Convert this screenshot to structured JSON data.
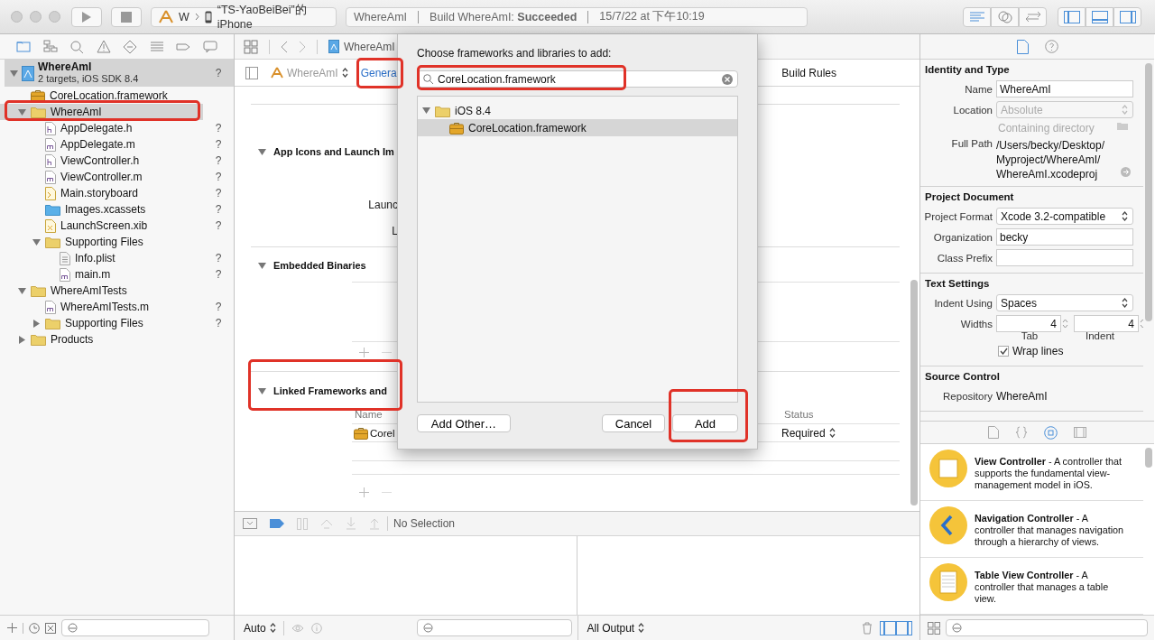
{
  "toolbar": {
    "scheme": "W",
    "device": "“TS-YaoBeiBei”的 iPhone",
    "activity": [
      "WhereAmI",
      "Build WhereAmI: **Succeeded**",
      "15/7/22 at 下午10:19"
    ]
  },
  "navigator": {
    "project": {
      "name": "WhereAmI",
      "subtitle": "2 targets, iOS SDK 8.4",
      "badge": "?",
      "expanded": true,
      "selected": true
    },
    "tree": [
      {
        "name": "CoreLocation.framework",
        "kind": "framework",
        "selected": false
      },
      {
        "name": "WhereAmI",
        "kind": "folder",
        "expanded": true,
        "selected": true,
        "children": [
          {
            "name": "AppDelegate.h",
            "kind": "header",
            "badge": "?",
            "selected": false
          },
          {
            "name": "AppDelegate.m",
            "kind": "source",
            "badge": "?",
            "selected": false
          },
          {
            "name": "ViewController.h",
            "kind": "header",
            "badge": "?",
            "selected": false
          },
          {
            "name": "ViewController.m",
            "kind": "source",
            "badge": "?",
            "selected": false
          },
          {
            "name": "Main.storyboard",
            "kind": "storyboard",
            "badge": "?",
            "selected": false
          },
          {
            "name": "Images.xcassets",
            "kind": "assets",
            "badge": "?",
            "selected": false
          },
          {
            "name": "LaunchScreen.xib",
            "kind": "xib",
            "badge": "?",
            "selected": false
          },
          {
            "name": "Supporting Files",
            "kind": "folder",
            "expanded": true,
            "selected": false,
            "children": [
              {
                "name": "Info.plist",
                "kind": "plist",
                "badge": "?",
                "selected": false
              },
              {
                "name": "main.m",
                "kind": "source",
                "badge": "?",
                "selected": false
              }
            ]
          }
        ]
      },
      {
        "name": "WhereAmITests",
        "kind": "folder",
        "expanded": true,
        "selected": false,
        "children": [
          {
            "name": "WhereAmITests.m",
            "kind": "source",
            "badge": "?",
            "selected": false
          },
          {
            "name": "Supporting Files",
            "kind": "folder",
            "expanded": false,
            "badge": "?",
            "selected": false
          }
        ]
      },
      {
        "name": "Products",
        "kind": "folder",
        "expanded": false,
        "selected": false
      }
    ]
  },
  "editor": {
    "breadcrumb": "WhereAmI",
    "target": "WhereAmI",
    "tabs": [
      {
        "label": "Genera",
        "selected": true
      },
      {
        "label": "Build Rules",
        "selected": false
      }
    ],
    "sections": [
      {
        "kind": "labels",
        "title": "App Icons and Launch Im",
        "expanded": true,
        "labels": [
          "Launc",
          "L"
        ]
      },
      {
        "kind": "empty",
        "title": "Embedded Binaries",
        "expanded": true
      },
      {
        "kind": "table",
        "title": "Linked Frameworks and",
        "expanded": true,
        "columns": [
          "Name",
          "Status"
        ],
        "rows": [
          {
            "name": "Corel",
            "status": "Required"
          }
        ]
      }
    ],
    "debug": {
      "status": "No Selection",
      "variables_filter": "Auto",
      "output_filter": "All Output"
    }
  },
  "dialog": {
    "title": "Choose frameworks and libraries to add:",
    "search": "CoreLocation.framework",
    "items": [
      {
        "name": "iOS 8.4",
        "kind": "folder",
        "expanded": true,
        "selected": false,
        "children": [
          {
            "name": "CoreLocation.framework",
            "kind": "framework",
            "selected": true
          }
        ]
      }
    ],
    "buttons": [
      "Add Other…",
      "Cancel",
      "Add"
    ]
  },
  "inspector": {
    "sections": [
      {
        "title": "Identity and Type",
        "rows": [
          {
            "kind": "field",
            "label": "Name",
            "value": "WhereAmI"
          },
          {
            "kind": "popup",
            "label": "Location",
            "value": "Absolute",
            "disabled": true
          },
          {
            "kind": "hint",
            "value": "Containing directory"
          },
          {
            "kind": "path",
            "label": "Full Path",
            "lines": [
              "/Users/becky/Desktop/",
              "Myproject/WhereAmI/",
              "WhereAmI.xcodeproj"
            ]
          }
        ]
      },
      {
        "title": "Project Document",
        "rows": [
          {
            "kind": "popup",
            "label": "Project Format",
            "value": "Xcode 3.2-compatible",
            "disabled": false
          },
          {
            "kind": "field",
            "label": "Organization",
            "value": "becky"
          },
          {
            "kind": "field",
            "label": "Class Prefix"
          }
        ]
      },
      {
        "title": "Text Settings",
        "rows": [
          {
            "kind": "popup",
            "label": "Indent Using",
            "value": "Spaces",
            "disabled": false
          },
          {
            "kind": "steppers",
            "label": "Widths",
            "fields": [
              {
                "value": "4",
                "caption": "Tab"
              },
              {
                "value": "4",
                "caption": "Indent"
              }
            ]
          },
          {
            "kind": "checkbox",
            "label": "Wrap lines",
            "checked": true
          }
        ]
      },
      {
        "title": "Source Control",
        "rows": [
          {
            "kind": "text",
            "label": "Repository",
            "value": "WhereAmI"
          }
        ]
      }
    ],
    "library": [
      {
        "kind": "view",
        "text": "**View Controller** - A controller that supports the fundamental view-management model in iOS."
      },
      {
        "kind": "navigation",
        "text": "**Navigation Controller** - A controller that manages navigation through a hierarchy of views."
      },
      {
        "kind": "table",
        "text": "**Table View Controller** - A controller that manages a table view."
      }
    ]
  }
}
